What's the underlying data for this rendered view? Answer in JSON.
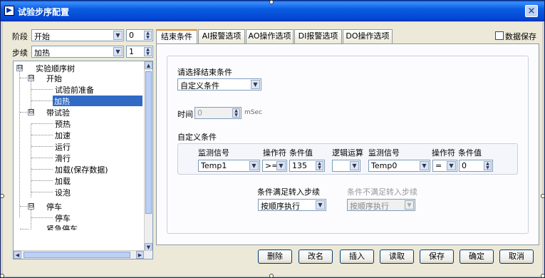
{
  "window": {
    "title": "试验步序配置",
    "close_glyph": "×"
  },
  "left": {
    "stage_label": "阶段",
    "stage_value": "开始",
    "stage_index": "0",
    "step_label": "步续",
    "step_value": "加热",
    "step_index": "1"
  },
  "tree": {
    "items": [
      {
        "label": "实验顺序树",
        "level": 0,
        "expander": "⊟"
      },
      {
        "label": "开始",
        "level": 1,
        "expander": "⊟"
      },
      {
        "label": "试验前准备",
        "level": 2
      },
      {
        "label": "加热",
        "level": 2,
        "selected": true
      },
      {
        "label": "带试验",
        "level": 1,
        "expander": "⊟"
      },
      {
        "label": "预热",
        "level": 2
      },
      {
        "label": "加速",
        "level": 2
      },
      {
        "label": "运行",
        "level": 2
      },
      {
        "label": "滑行",
        "level": 2
      },
      {
        "label": "加载(保存数据)",
        "level": 2
      },
      {
        "label": "加载",
        "level": 2
      },
      {
        "label": "设泡",
        "level": 2
      },
      {
        "label": "停车",
        "level": 1,
        "expander": "⊟"
      },
      {
        "label": "停车",
        "level": 2
      },
      {
        "label": "紧急停车",
        "level": 1
      }
    ]
  },
  "tabs": [
    "结束条件",
    "AI报警选项",
    "AO操作选项",
    "DI报警选项",
    "DO操作选项"
  ],
  "save_data_label": "数据保存",
  "panel": {
    "end_condition_label": "请选择结束条件",
    "end_condition_value": "自定义条件",
    "time_label": "时间",
    "time_value": "0",
    "time_unit": "mSec",
    "custom_label": "自定义条件",
    "headers": {
      "signal1": "监测信号",
      "op1": "操作符",
      "val1": "条件值",
      "logic": "逻辑运算",
      "signal2": "监测信号",
      "op2": "操作符",
      "val2": "条件值"
    },
    "row": {
      "signal1": "Temp1",
      "op1": ">=",
      "val1": "135",
      "logic": "",
      "signal2": "Temp0",
      "op2": "=",
      "val2": "0"
    },
    "true_step_label": "条件满足转入步续",
    "true_step_value": "按顺序执行",
    "false_step_label": "条件不满足转入步续",
    "false_step_value": "按顺序执行"
  },
  "buttons": {
    "delete": "删除",
    "rename": "改名",
    "insert": "插入",
    "load": "读取",
    "save": "保存",
    "ok": "确定",
    "cancel": "取消"
  },
  "glyphs": {
    "down": "▼",
    "up": "▲",
    "left": "◀",
    "right": "▶"
  }
}
